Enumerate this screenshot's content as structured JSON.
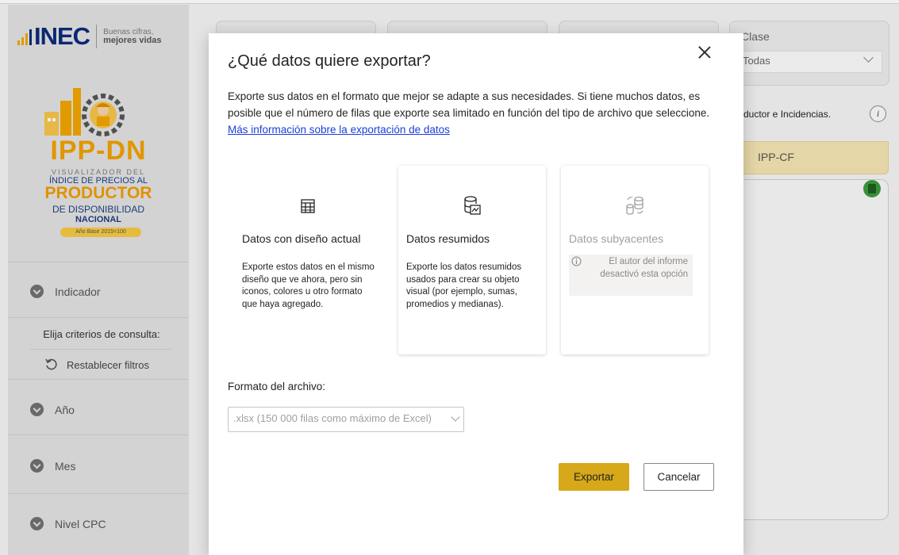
{
  "brand": {
    "logo_text": "INEC",
    "tagline_line1": "Buenas cifras,",
    "tagline_line2": "mejores vidas"
  },
  "sidebar": {
    "ipp_title": "IPP-DN",
    "visualizer_label": "VISUALIZADOR DEL",
    "index_label": "ÍNDICE DE PRECIOS AL",
    "producer_label": "PRODUCTOR",
    "availability_label": "DE DISPONIBILIDAD",
    "national_label": "NACIONAL",
    "base_year_label": "Año Base 2015=100",
    "indicator_label": "Indicador",
    "criteria_label": "Elija criterios de consulta:",
    "reset_label": "Restablecer filtros",
    "year_label": "Año",
    "month_label": "Mes",
    "cpc_label": "Nivel CPC"
  },
  "filters": {
    "clase_label": "Clase",
    "clase_value": "Todas",
    "incidence_text": "ductor e Incidencias.",
    "info_symbol": "i",
    "ippcf_label": "IPP-CF"
  },
  "dialog": {
    "title": "¿Qué datos quiere exportar?",
    "description": "Exporte sus datos en el formato que mejor se adapte a sus necesidades. Si tiene muchos datos, es posible que el número de filas que exporte sea limitado en función del tipo de archivo que seleccione.",
    "link_text": "Más información sobre la exportación de datos",
    "options": [
      {
        "title": "Datos con diseño actual",
        "description": "Exporte estos datos en el mismo diseño que ve ahora, pero sin iconos, colores u otro formato que haya agregado.",
        "icon": "table-icon"
      },
      {
        "title": "Datos resumidos",
        "description": "Exporte los datos resumidos usados para crear su objeto visual (por ejemplo, sumas, promedios y medianas).",
        "icon": "database-chart-icon"
      },
      {
        "title": "Datos subyacentes",
        "note": "El autor del informe desactivó esta opción",
        "icon": "database-sync-icon"
      }
    ],
    "format_label": "Formato del archivo:",
    "format_value": ".xlsx (150 000 filas como máximo de Excel)",
    "export_label": "Exportar",
    "cancel_label": "Cancelar"
  },
  "colors": {
    "accent": "#d6a81a",
    "link": "#1a3fd6",
    "brand_orange": "#f0a000",
    "brand_blue": "#0b2b7a"
  }
}
